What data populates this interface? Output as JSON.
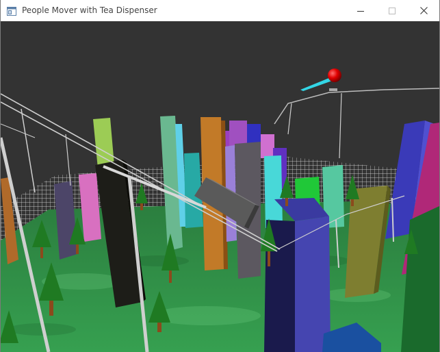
{
  "window": {
    "title": "People Mover with Tea Dispenser",
    "icon": "app-window-icon",
    "controls": {
      "minimize": "minimize-icon",
      "maximize": "maximize-icon",
      "close": "close-icon"
    }
  },
  "scene": {
    "background_color": "#333333",
    "ground_color": "#2f8f45",
    "grid_color": "#ffffff",
    "rail_color": "#c8c8c8",
    "marker_ball_color": "#e00000",
    "laser_color": "#33d6e6",
    "tree_color": "#1e6e1e",
    "trunk_color": "#8b4a1c",
    "car_color": "#5a5a5a"
  }
}
